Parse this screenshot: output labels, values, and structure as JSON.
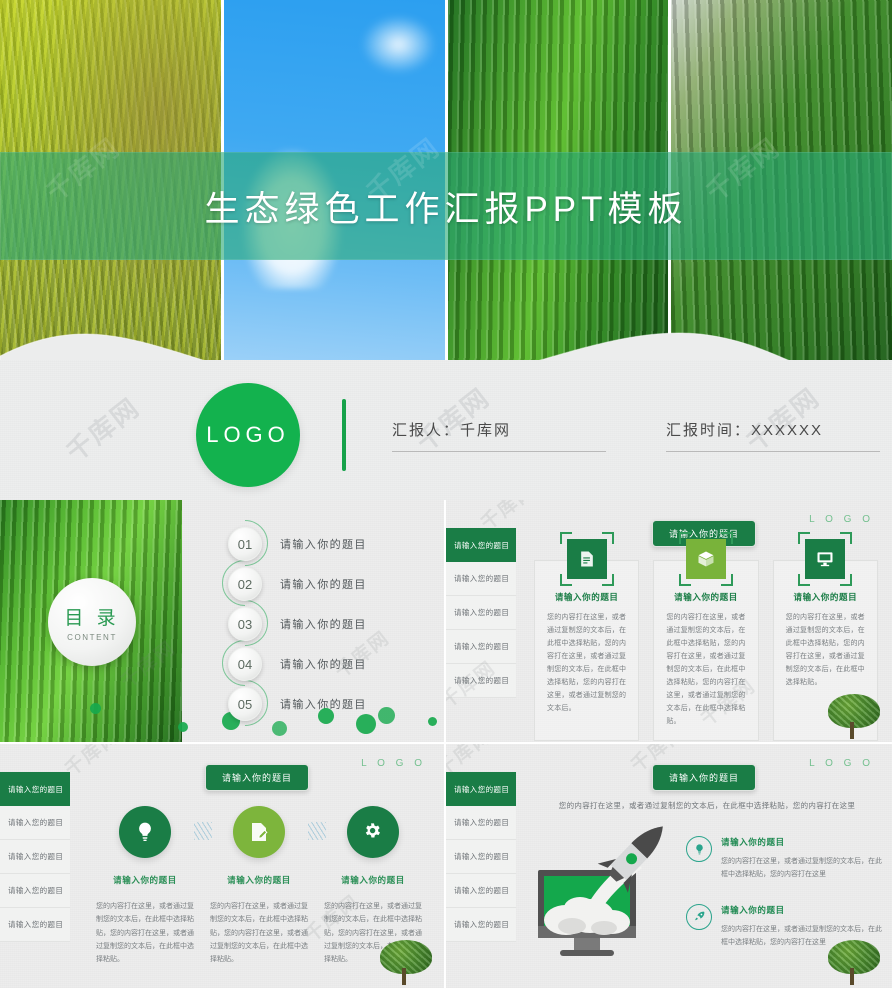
{
  "cover": {
    "title": "生态绿色工作汇报PPT模板",
    "logo": "LOGO",
    "presenter_label": "汇报人：千库网",
    "date_label": "汇报时间：XXXXXX",
    "photos": [
      {
        "name": "yellow-bamboo-leaves"
      },
      {
        "name": "blue-sky-with-cloud"
      },
      {
        "name": "green-rice-grass"
      },
      {
        "name": "green-rice-ear"
      }
    ]
  },
  "watermark": {
    "text": "千库网"
  },
  "colors": {
    "brand_green": "#13b24e",
    "dark_green": "#1a7d46",
    "light_green": "#79b33a",
    "teal": "#2aa48c",
    "band_green": "#2aaa78",
    "panel_gray": "#ececec"
  },
  "toc_slide": {
    "heading_cn": "目 录",
    "heading_en": "CONTENT",
    "items": [
      {
        "num": "01",
        "label": "请输入你的题目"
      },
      {
        "num": "02",
        "label": "请输入你的题目"
      },
      {
        "num": "03",
        "label": "请输入你的题目"
      },
      {
        "num": "04",
        "label": "请输入你的题目"
      },
      {
        "num": "05",
        "label": "请输入你的题目"
      }
    ]
  },
  "cards_slide": {
    "logo": "L O G O",
    "title_badge": "请输入你的题目",
    "side_nav": [
      {
        "label": "请输入您的题目",
        "active": true
      },
      {
        "label": "请输入您的题目",
        "active": false
      },
      {
        "label": "请输入您的题目",
        "active": false
      },
      {
        "label": "请输入您的题目",
        "active": false
      },
      {
        "label": "请输入您的题目",
        "active": false
      }
    ],
    "cards": [
      {
        "icon": "document-icon",
        "title": "请输入你的题目",
        "text": "您的内容打在这里，或者通过复制您的文本后，在此框中选择粘贴，您的内容打在这里，或者通过复制您的文本后，在此框中选择粘贴，您的内容打在这里，或者通过复制您的文本后。"
      },
      {
        "icon": "box-icon",
        "title": "请输入你的题目",
        "text": "您的内容打在这里，或者通过复制您的文本后，在此框中选择粘贴，您的内容打在这里，或者通过复制您的文本后，在此框中选择粘贴，您的内容打在这里，或者通过复制您的文本后，在此框中选择粘贴。"
      },
      {
        "icon": "monitor-icon",
        "title": "请输入你的题目",
        "text": "您的内容打在这里，或者通过复制您的文本后，在此框中选择粘贴，您的内容打在这里，或者通过复制您的文本后，在此框中选择粘贴。"
      }
    ]
  },
  "circles_slide": {
    "logo": "L O G O",
    "title_badge": "请输入你的题目",
    "side_nav": [
      {
        "label": "请输入您的题目",
        "active": true
      },
      {
        "label": "请输入您的题目",
        "active": false
      },
      {
        "label": "请输入您的题目",
        "active": false
      },
      {
        "label": "请输入您的题目",
        "active": false
      },
      {
        "label": "请输入您的题目",
        "active": false
      }
    ],
    "columns": [
      {
        "icon": "lightbulb-icon",
        "title": "请输入你的题目",
        "text": "您的内容打在这里，或者通过复制您的文本后，在此框中选择粘贴，您的内容打在这里，或者通过复制您的文本后，在此框中选择粘贴。"
      },
      {
        "icon": "edit-document-icon",
        "title": "请输入你的题目",
        "text": "您的内容打在这里，或者通过复制您的文本后，在此框中选择粘贴，您的内容打在这里，或者通过复制您的文本后，在此框中选择粘贴。"
      },
      {
        "icon": "gear-icon",
        "title": "请输入你的题目",
        "text": "您的内容打在这里，或者通过复制您的文本后，在此框中选择粘贴，您的内容打在这里，或者通过复制您的文本后，在此框中选择粘贴。"
      }
    ]
  },
  "rocket_slide": {
    "logo": "L O G O",
    "title_badge": "请输入你的题目",
    "lead_text": "您的内容打在这里，或者通过复制您的文本后，在此框中选择粘贴，您的内容打在这里",
    "side_nav": [
      {
        "label": "请输入您的题目",
        "active": true
      },
      {
        "label": "请输入您的题目",
        "active": false
      },
      {
        "label": "请输入您的题目",
        "active": false
      },
      {
        "label": "请输入您的题目",
        "active": false
      },
      {
        "label": "请输入您的题目",
        "active": false
      }
    ],
    "illustration": "rocket-launching-from-monitor",
    "bullets": [
      {
        "icon": "lightbulb-icon",
        "title": "请输入你的题目",
        "text": "您的内容打在这里，或者通过复制您的文本后，在此框中选择粘贴，您的内容打在这里"
      },
      {
        "icon": "rocket-icon",
        "title": "请输入你的题目",
        "text": "您的内容打在这里，或者通过复制您的文本后，在此框中选择粘贴，您的内容打在这里"
      }
    ]
  }
}
